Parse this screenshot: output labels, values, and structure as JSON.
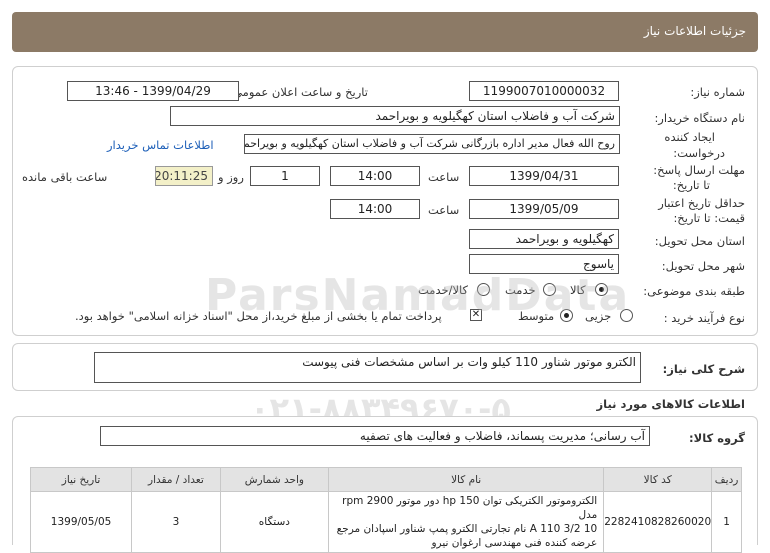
{
  "header": {
    "title": "جزئیات اطلاعات نیاز"
  },
  "form": {
    "need_number_label": "شماره نیاز:",
    "need_number": "1199007010000032",
    "announce_label": "تاریخ و ساعت اعلان عمومی:",
    "announce_value": "1399/04/29 - 13:46",
    "buyer_label": "نام دستگاه خریدار:",
    "buyer_value": "شرکت آب و فاضلاب استان کهگیلویه و بویراحمد",
    "creator_label_1": "ایجاد کننده",
    "creator_label_2": "درخواست:",
    "creator_value": "روح الله فعال مدیر اداره بازرگانی شرکت آب و فاضلاب استان کهگیلویه و بویراحمد",
    "contact_link": "اطلاعات تماس خریدار",
    "deadline_label_1": "مهلت ارسال پاسخ:",
    "deadline_label_2": "تا تاریخ:",
    "deadline_date": "1399/04/31",
    "time_label": "ساعت",
    "deadline_time": "14:00",
    "days_value": "1",
    "days_label": "روز و",
    "remaining_timer": "20:11:25",
    "remaining_label": "ساعت باقی مانده",
    "validity_label_1": "حداقل تاریخ اعتبار",
    "validity_label_2": "قیمت: تا تاریخ:",
    "validity_date": "1399/05/09",
    "validity_time_label": "ساعت",
    "validity_time": "14:00",
    "province_label": "استان محل تحویل:",
    "province_value": "کهگیلویه و بویراحمد",
    "city_label": "شهر محل تحویل:",
    "city_value": "یاسوج",
    "category_label": "طبقه بندی موضوعی:",
    "category_options": [
      "کالا",
      "خدمت",
      "کالا/خدمت"
    ],
    "category_selected": "کالا",
    "process_label": "نوع فرآیند خرید :",
    "process_options": [
      "جزیی",
      "متوسط"
    ],
    "process_selected": "متوسط",
    "payment_note": "پرداخت تمام یا بخشی از مبلغ خرید،از محل \"اسناد خزانه اسلامی\" خواهد بود."
  },
  "summary": {
    "label": "شرح کلی نیاز:",
    "value": "الکترو موتور شناور 110 کیلو وات بر اساس مشخصات فنی پیوست"
  },
  "goods_section": {
    "title": "اطلاعات کالاهای مورد نیاز",
    "group_label": "گروه کالا:",
    "group_value": "آب رسانی؛ مدیریت پسماند، فاضلاب و فعالیت های تصفیه"
  },
  "table": {
    "headers": [
      "ردیف",
      "کد کالا",
      "نام کالا",
      "واحد شمارش",
      "تعداد / مقدار",
      "تاریخ نیاز"
    ],
    "rows": [
      {
        "row": "1",
        "code": "2282410828260020",
        "name_line1": "الکتروموتور الکتریکی توان 150 hp دور موتور 2900 rpm مدل",
        "name_line2": "10 3/2 110 A نام تجارتی الکترو پمپ شناور اسپادان مرجع",
        "name_line3": "عرضه کننده فنی مهندسی ارغوان نیرو",
        "unit": "دستگاه",
        "qty": "3",
        "date": "1399/05/05"
      }
    ]
  },
  "watermark": {
    "line1": "ParsNamadData",
    "line2": "پایگاه اطلاع رسانی مناقصه و مزایده",
    "line3": "۰۲۱-۸۸۳۴۹۶۷۰-۵"
  },
  "colors": {
    "header_bg": "#8c7a66",
    "link": "#1d5fb8",
    "timer_bg": "#f3f0c8",
    "table_header_bg": "#e3e3e3"
  }
}
